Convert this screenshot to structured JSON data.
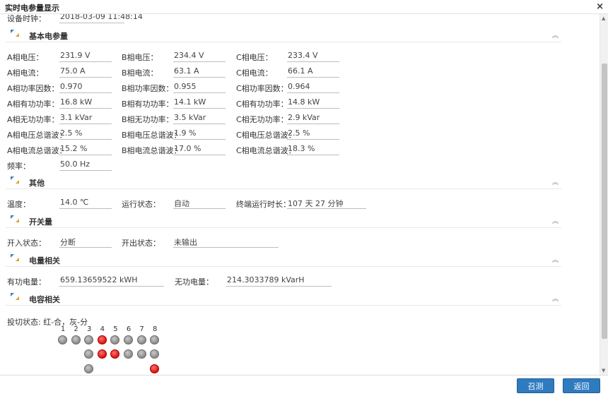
{
  "window": {
    "title": "实时电参量显示",
    "close": "×"
  },
  "device_time": {
    "label": "设备时钟：",
    "value": "2018-03-09 11:48:14"
  },
  "sections": {
    "basic": "基本电参量",
    "other": "其他",
    "switch": "开关量",
    "energy": "电量相关",
    "capacitor": "电容相关"
  },
  "basic": {
    "rows": [
      {
        "a_label": "A相电压：",
        "a_value": "231.9 V",
        "b_label": "B相电压：",
        "b_value": "234.4 V",
        "c_label": "C相电压：",
        "c_value": "233.4 V"
      },
      {
        "a_label": "A相电流：",
        "a_value": "75.0 A",
        "b_label": "B相电流：",
        "b_value": "63.1 A",
        "c_label": "C相电流：",
        "c_value": "66.1 A"
      },
      {
        "a_label": "A相功率因数：",
        "a_value": "0.970",
        "b_label": "B相功率因数：",
        "b_value": "0.955",
        "c_label": "C相功率因数：",
        "c_value": "0.964"
      },
      {
        "a_label": "A相有功功率：",
        "a_value": "16.8 kW",
        "b_label": "B相有功功率：",
        "b_value": "14.1 kW",
        "c_label": "C相有功功率：",
        "c_value": "14.8 kW"
      },
      {
        "a_label": "A相无功功率：",
        "a_value": "3.1 kVar",
        "b_label": "B相无功功率：",
        "b_value": "3.5 kVar",
        "c_label": "C相无功功率：",
        "c_value": "2.9 kVar"
      },
      {
        "a_label": "A相电压总谐波：",
        "a_value": "2.5 %",
        "b_label": "B相电压总谐波：",
        "b_value": "1.9 %",
        "c_label": "C相电压总谐波：",
        "c_value": "2.5 %"
      },
      {
        "a_label": "A相电流总谐波：",
        "a_value": "15.2 %",
        "b_label": "B相电流总谐波：",
        "b_value": "17.0 %",
        "c_label": "C相电流总谐波：",
        "c_value": "18.3 %"
      }
    ],
    "frequency": {
      "label": "频率：",
      "value": "50.0 Hz"
    }
  },
  "other": {
    "temp_label": "温度：",
    "temp_value": "14.0 ℃",
    "status_label": "运行状态：",
    "status_value": "自动",
    "runtime_label": "终端运行时长：",
    "runtime_value": "107 天 27 分钟"
  },
  "switch": {
    "in_label": "开入状态：",
    "in_value": "分断",
    "out_label": "开出状态：",
    "out_value": "未输出"
  },
  "energy": {
    "active_label": "有功电量：",
    "active_value": "659.13659522 kWH",
    "reactive_label": "无功电量：",
    "reactive_value": "214.3033789 kVarH"
  },
  "capacitor": {
    "legend": "投切状态: 红-合，灰-分",
    "numbers": [
      "1",
      "2",
      "3",
      "4",
      "5",
      "6",
      "7",
      "8"
    ],
    "states": [
      [
        "off",
        "off",
        "off",
        "on",
        "off",
        "off",
        "off",
        "off"
      ],
      [
        null,
        null,
        "off",
        "on",
        "on",
        "off",
        "off",
        "off"
      ],
      [
        null,
        null,
        "off",
        null,
        null,
        null,
        null,
        "on"
      ]
    ]
  },
  "buttons": {
    "summon": "召测",
    "back": "返回"
  },
  "colors": {
    "accent": "#2f7bbf",
    "on": "#e01010",
    "off": "#8a8a8a"
  }
}
